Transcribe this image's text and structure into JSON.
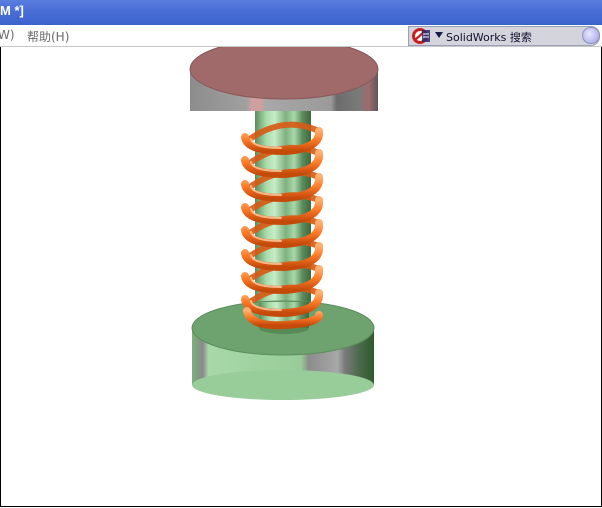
{
  "window": {
    "title": "M *]"
  },
  "menubar": {
    "items": [
      {
        "label": "W)"
      },
      {
        "label": "帮助(H)"
      }
    ]
  },
  "search": {
    "label": "SolidWorks 搜索"
  },
  "colors": {
    "top_plate": "#a06a6a",
    "spring": "#ff7a26",
    "rod": "#9ccc9c",
    "base_plate": "#6ea26e"
  },
  "icons": {
    "search_logo": "solidworks-logo-icon",
    "dropdown": "dropdown-arrow-icon",
    "search_go": "search-go-icon"
  }
}
